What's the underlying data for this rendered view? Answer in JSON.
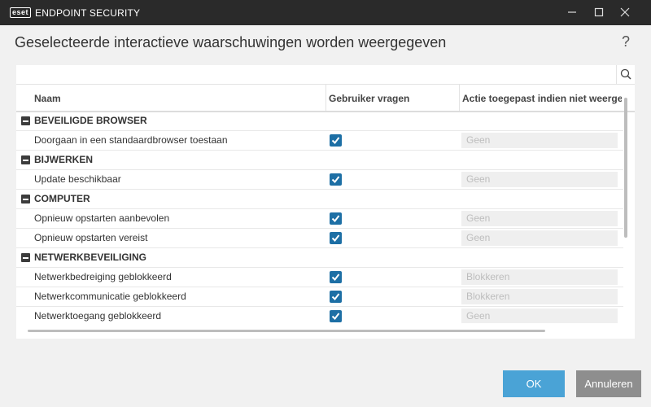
{
  "window": {
    "brand": "eset",
    "title": "ENDPOINT SECURITY",
    "minimize_icon": "minimize-icon",
    "maximize_icon": "maximize-icon",
    "close_icon": "close-icon"
  },
  "dialog": {
    "heading": "Geselecteerde interactieve waarschuwingen worden weergegeven",
    "help": "?"
  },
  "search": {
    "value": "",
    "icon": "search-icon"
  },
  "table": {
    "columns": [
      "Naam",
      "Gebruiker vragen",
      "Actie toegepast indien niet weergegeven"
    ],
    "groups": [
      {
        "label": "BEVEILIGDE BROWSER",
        "items": [
          {
            "name": "Doorgaan in een standaardbrowser toestaan",
            "ask_user": true,
            "action": "Geen"
          }
        ]
      },
      {
        "label": "BIJWERKEN",
        "items": [
          {
            "name": "Update beschikbaar",
            "ask_user": true,
            "action": "Geen"
          }
        ]
      },
      {
        "label": "COMPUTER",
        "items": [
          {
            "name": "Opnieuw opstarten aanbevolen",
            "ask_user": true,
            "action": "Geen"
          },
          {
            "name": "Opnieuw opstarten vereist",
            "ask_user": true,
            "action": "Geen"
          }
        ]
      },
      {
        "label": "NETWERKBEVEILIGING",
        "items": [
          {
            "name": "Netwerkbedreiging geblokkeerd",
            "ask_user": true,
            "action": "Blokkeren"
          },
          {
            "name": "Netwerkcommunicatie geblokkeerd",
            "ask_user": true,
            "action": "Blokkeren"
          },
          {
            "name": "Netwerktoegang geblokkeerd",
            "ask_user": true,
            "action": "Geen"
          }
        ]
      }
    ]
  },
  "buttons": {
    "ok": "OK",
    "cancel": "Annuleren"
  },
  "colors": {
    "titlebar": "#2a2a2a",
    "checkbox": "#1d6fa5",
    "ok_button": "#4aa3d6",
    "cancel_button": "#8e8e8e"
  }
}
